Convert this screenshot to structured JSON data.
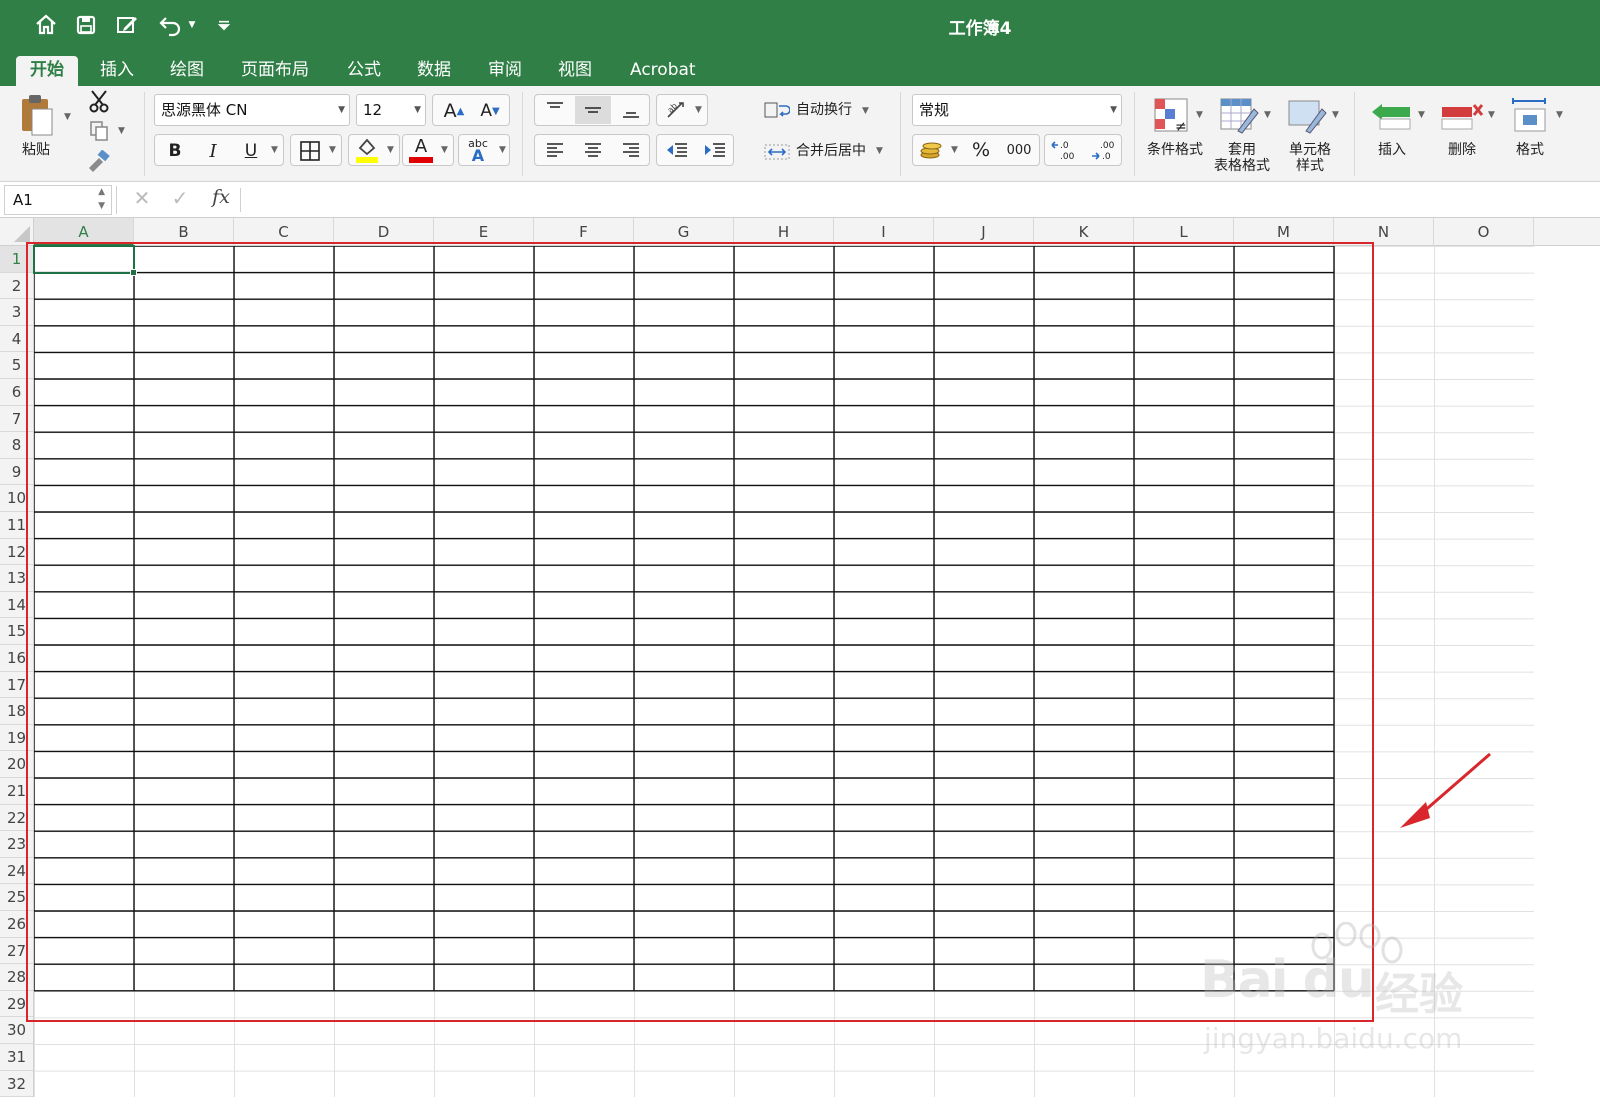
{
  "window": {
    "title": "工作簿4"
  },
  "tabs": [
    {
      "label": "开始",
      "active": true
    },
    {
      "label": "插入"
    },
    {
      "label": "绘图"
    },
    {
      "label": "页面布局"
    },
    {
      "label": "公式"
    },
    {
      "label": "数据"
    },
    {
      "label": "审阅"
    },
    {
      "label": "视图"
    },
    {
      "label": "Acrobat"
    }
  ],
  "ribbon": {
    "paste_label": "粘贴",
    "font_name": "思源黑体 CN",
    "font_size": "12",
    "bold": "B",
    "italic": "I",
    "underline": "U",
    "font_color_glyph": "A",
    "phonetic_glyph": "abc",
    "wrap_text": "自动换行",
    "merge_center": "合并后居中",
    "number_format": "常规",
    "percent": "%",
    "comma_style": "000",
    "conditional_format": "条件格式",
    "format_as_table": "套用\n表格格式",
    "cell_styles": "单元格\n样式",
    "insert": "插入",
    "delete": "删除",
    "format": "格式",
    "fill_color": "#ffff00",
    "font_color": "#e00000"
  },
  "formula_bar": {
    "name_box": "A1",
    "fx": "fx",
    "formula": ""
  },
  "sheet": {
    "columns": [
      "A",
      "B",
      "C",
      "D",
      "E",
      "F",
      "G",
      "H",
      "I",
      "J",
      "K",
      "L",
      "M",
      "N",
      "O"
    ],
    "rows": [
      "1",
      "2",
      "3",
      "4",
      "5",
      "6",
      "7",
      "8",
      "9",
      "10",
      "11",
      "12",
      "13",
      "14",
      "15",
      "16",
      "17",
      "18",
      "19",
      "20",
      "21",
      "22",
      "23",
      "24",
      "25",
      "26",
      "27",
      "28",
      "29",
      "30",
      "31",
      "32"
    ],
    "selected_cell": "A1",
    "bordered_range": "A1:M28",
    "annotation_color": "#d9262c"
  },
  "watermark": {
    "brand": "Bai du",
    "brand_cn": "经验",
    "url": "jingyan.baidu.com"
  }
}
